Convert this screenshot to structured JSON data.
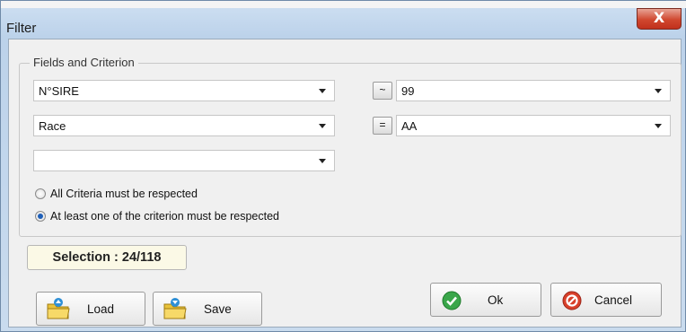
{
  "window": {
    "title": "Filter",
    "close_label": "X"
  },
  "criteria_group": {
    "legend": "Fields and Criterion",
    "rows": [
      {
        "field": "N°SIRE",
        "operator": "~",
        "value": "99"
      },
      {
        "field": "Race",
        "operator": "=",
        "value": "AA"
      },
      {
        "field": ""
      }
    ]
  },
  "match_mode": {
    "options": [
      {
        "label": "All Criteria must be respected",
        "selected": false
      },
      {
        "label": "At least one of the criterion must be respected",
        "selected": true
      }
    ]
  },
  "selection": {
    "text": "Selection : 24/118"
  },
  "buttons": {
    "load": "Load",
    "save": "Save",
    "ok": "Ok",
    "cancel": "Cancel"
  },
  "colors": {
    "accent": "#1e5fb8",
    "ok_green": "#3aa64a",
    "cancel_red": "#d9412b",
    "close_red": "#d0472f"
  },
  "icons": {
    "load": "folder-load-icon",
    "save": "folder-save-icon",
    "ok": "check-circle-icon",
    "cancel": "forbidden-icon"
  }
}
